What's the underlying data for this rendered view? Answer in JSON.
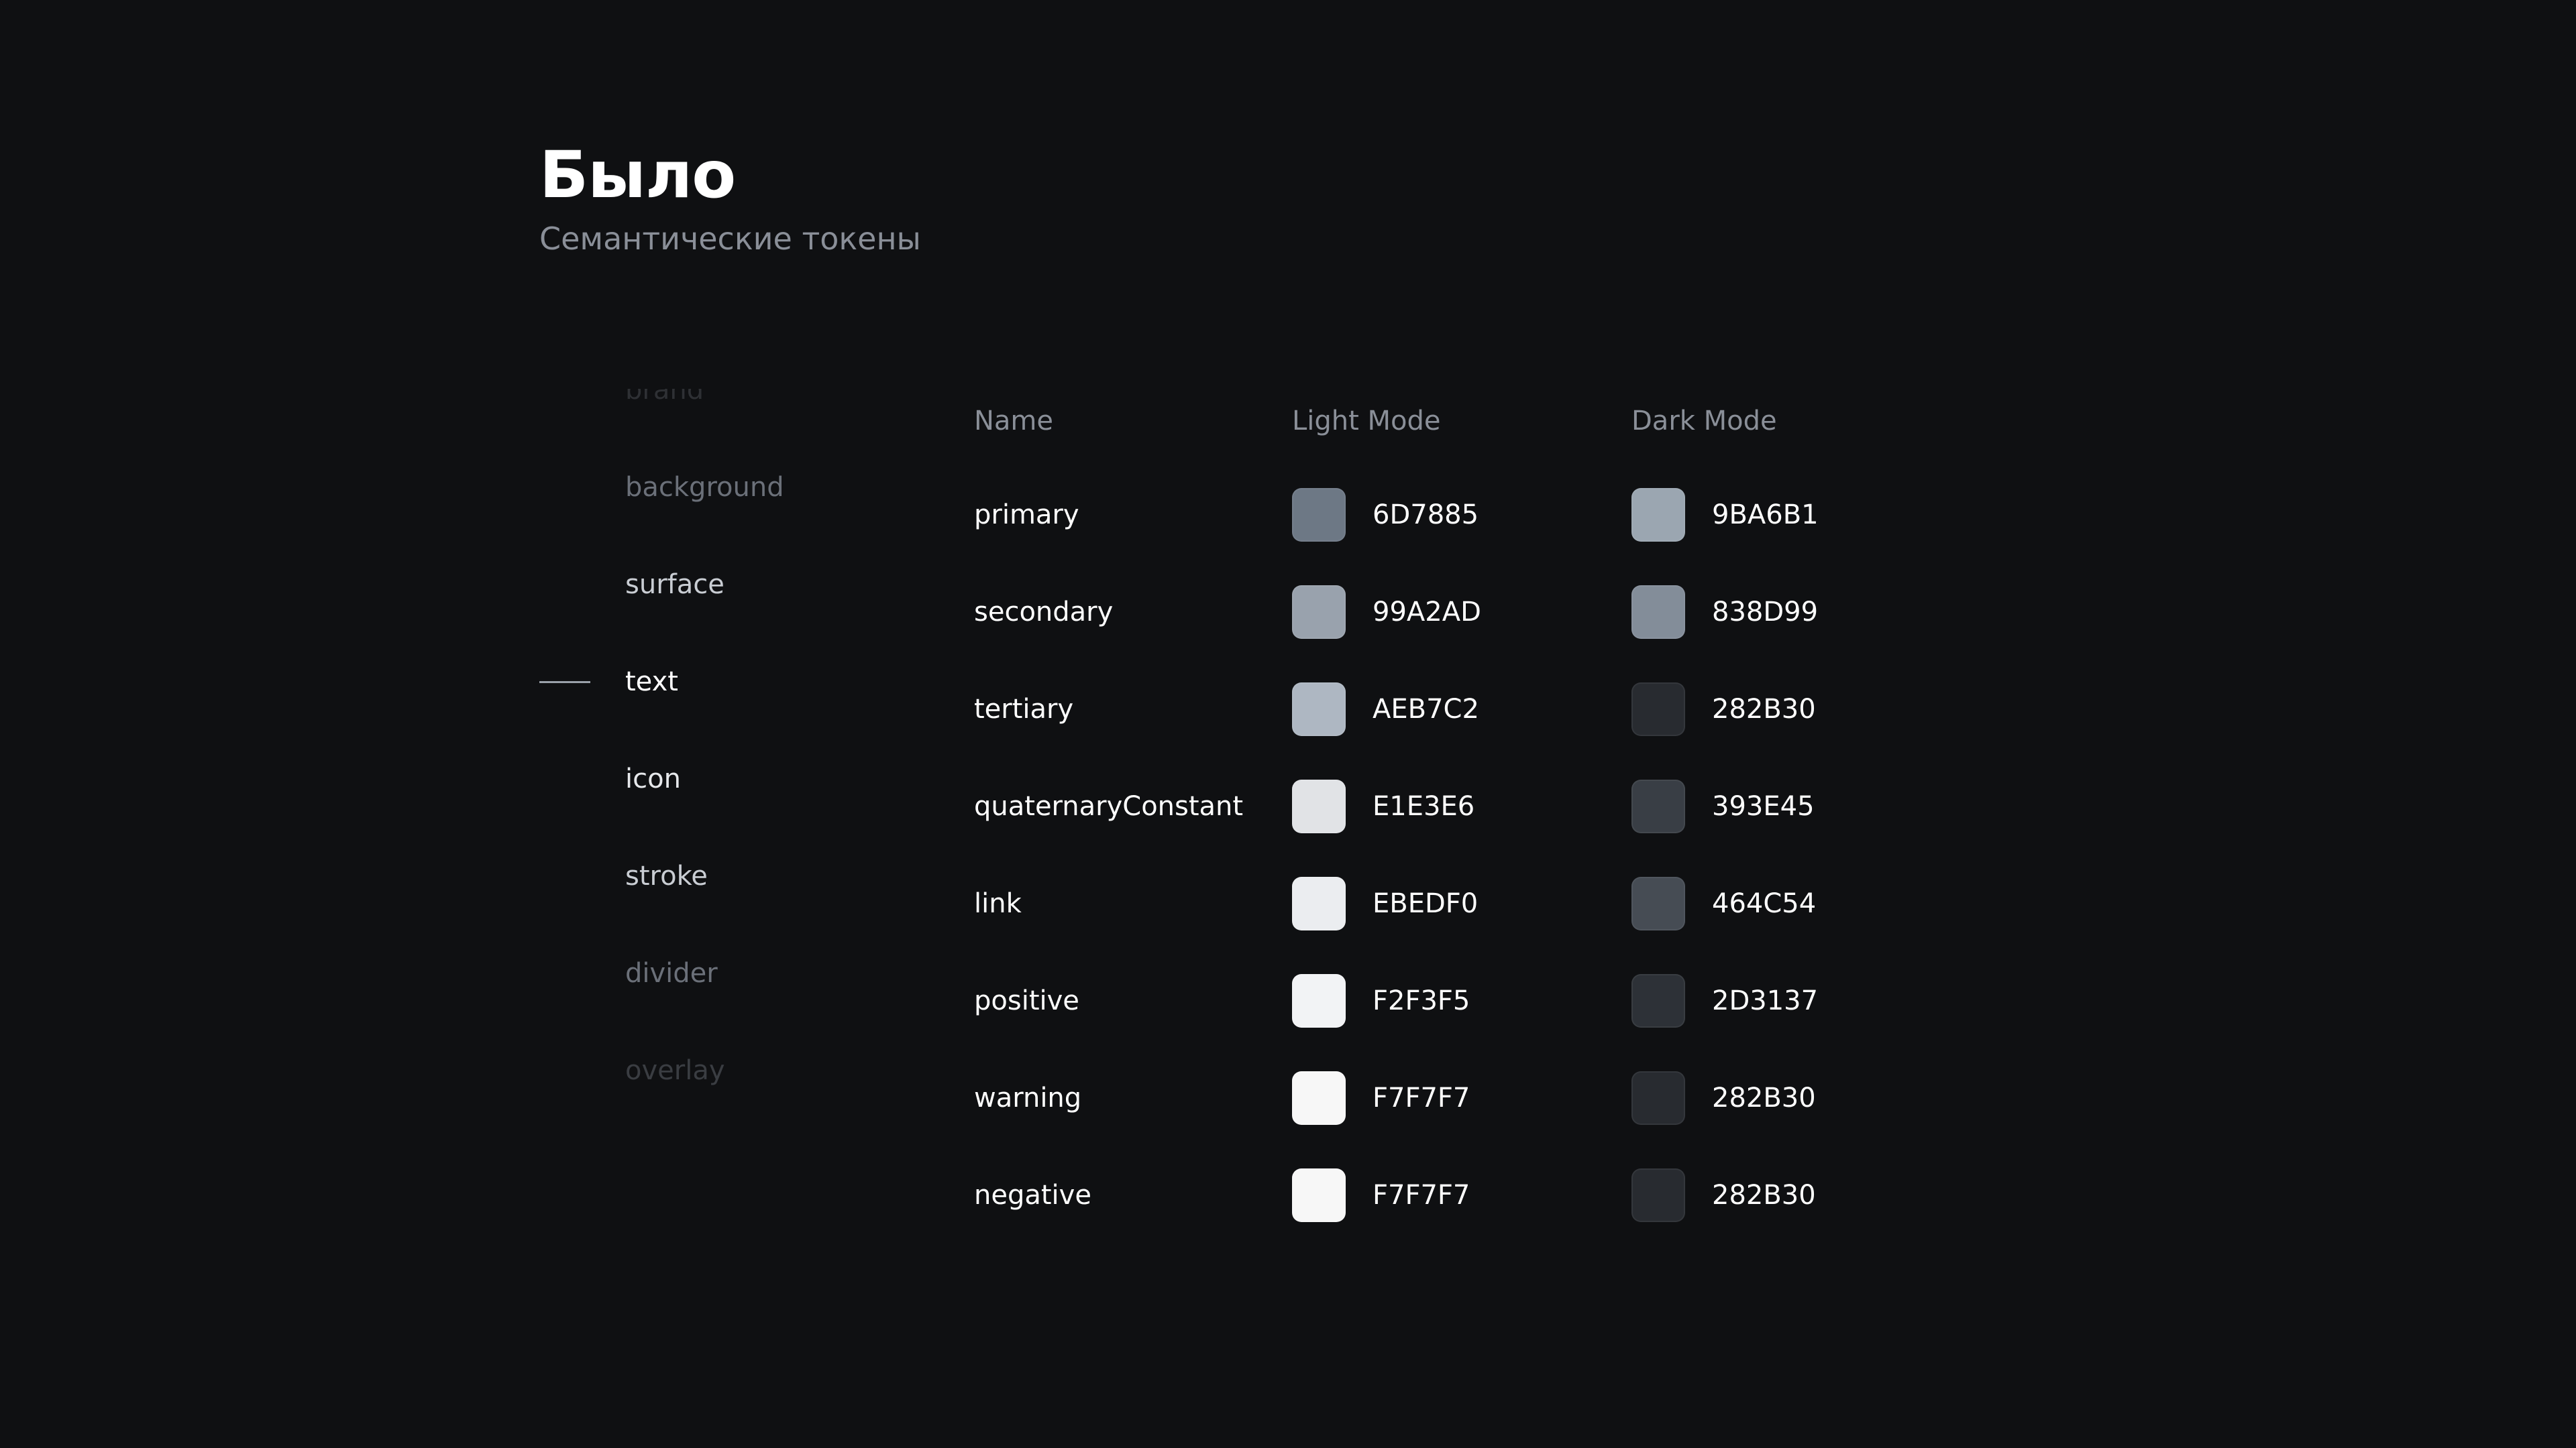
{
  "header": {
    "title": "Было",
    "subtitle": "Семантические токены"
  },
  "side_nav": {
    "items": [
      {
        "label": "brand",
        "color": "#2E3034"
      },
      {
        "label": "background",
        "color": "#6B7079"
      },
      {
        "label": "surface",
        "color": "#C9CDD3"
      },
      {
        "label": "text",
        "color": "#FFFFFF",
        "active": true
      },
      {
        "label": "icon",
        "color": "#E6E8EB"
      },
      {
        "label": "stroke",
        "color": "#C9CDD3"
      },
      {
        "label": "divider",
        "color": "#6B7079"
      },
      {
        "label": "overlay",
        "color": "#3A3D42"
      }
    ]
  },
  "table": {
    "columns": [
      "Name",
      "Light Mode",
      "Dark Mode"
    ],
    "rows": [
      {
        "name": "primary",
        "light": "6D7885",
        "dark": "9BA6B1"
      },
      {
        "name": "secondary",
        "light": "99A2AD",
        "dark": "838D99"
      },
      {
        "name": "tertiary",
        "light": "AEB7C2",
        "dark": "282B30"
      },
      {
        "name": "quaternaryConstant",
        "light": "E1E3E6",
        "dark": "393E45"
      },
      {
        "name": "link",
        "light": "EBEDF0",
        "dark": "464C54"
      },
      {
        "name": "positive",
        "light": "F2F3F5",
        "dark": "2D3137"
      },
      {
        "name": "warning",
        "light": "F7F7F7",
        "dark": "282B30"
      },
      {
        "name": "negative",
        "light": "F7F7F7",
        "dark": "282B30"
      }
    ]
  }
}
